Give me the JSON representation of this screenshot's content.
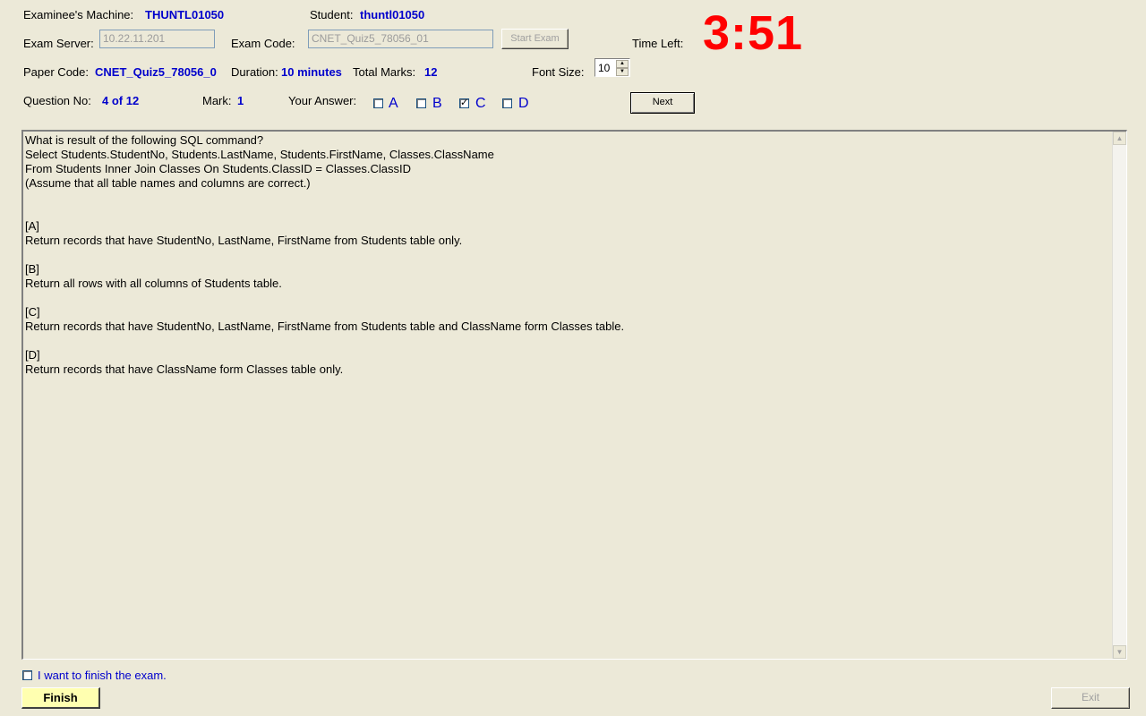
{
  "header": {
    "machine_label": "Examinee's Machine:",
    "machine_value": "THUNTL01050",
    "student_label": "Student:",
    "student_value": "thuntl01050",
    "server_label": "Exam Server:",
    "server_value": "10.22.11.201",
    "exam_code_label": "Exam Code:",
    "exam_code_value": "CNET_Quiz5_78056_01",
    "start_exam_label": "Start Exam",
    "time_left_label": "Time Left:",
    "time_left_value": "3:51",
    "paper_code_label": "Paper Code:",
    "paper_code_value": "CNET_Quiz5_78056_0",
    "duration_label": "Duration:",
    "duration_value": "10 minutes",
    "total_marks_label": "Total Marks:",
    "total_marks_value": "12",
    "font_size_label": "Font Size:",
    "font_size_value": "10",
    "question_no_label": "Question No:",
    "question_no_value": "4 of 12",
    "mark_label": "Mark:",
    "mark_value": "1",
    "your_answer_label": "Your Answer:",
    "next_label": "Next"
  },
  "answers": [
    {
      "label": "A",
      "checked": false
    },
    {
      "label": "B",
      "checked": false
    },
    {
      "label": "C",
      "checked": true
    },
    {
      "label": "D",
      "checked": false
    }
  ],
  "question_text": "What is result of the following SQL command?\nSelect Students.StudentNo, Students.LastName, Students.FirstName, Classes.ClassName\nFrom Students Inner Join Classes On Students.ClassID = Classes.ClassID\n(Assume that all table names and columns are correct.)\n\n\n[A]\nReturn records that have StudentNo, LastName, FirstName from Students table only.\n\n[B]\nReturn all rows with all columns of Students table.\n\n[C]\nReturn records that have StudentNo, LastName, FirstName from Students table and ClassName form Classes table.\n\n[D]\nReturn records that have ClassName form Classes table only.",
  "footer": {
    "finish_checkbox_label": "I want to finish the exam.",
    "finish_checked": false,
    "finish_label": "Finish",
    "exit_label": "Exit"
  },
  "colors": {
    "background": "#ece9d8",
    "value_text": "#0000cc",
    "timer": "#ff0000",
    "finish_button": "#ffffb0"
  }
}
